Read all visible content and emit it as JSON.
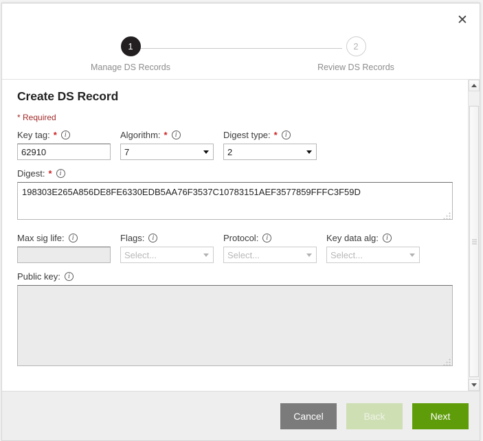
{
  "dialog": {
    "close_label": "✕"
  },
  "stepper": {
    "steps": [
      {
        "number": "1",
        "label": "Manage DS Records",
        "state": "active"
      },
      {
        "number": "2",
        "label": "Review DS Records",
        "state": "inactive"
      }
    ]
  },
  "form": {
    "title": "Create DS Record",
    "required_note": "* Required",
    "info_icon": "info-icon",
    "fields": {
      "key_tag": {
        "label": "Key tag:",
        "required": "*",
        "value": "62910",
        "placeholder": ""
      },
      "algorithm": {
        "label": "Algorithm:",
        "required": "*",
        "value": "7",
        "options": [
          "7"
        ]
      },
      "digest_type": {
        "label": "Digest type:",
        "required": "*",
        "value": "2",
        "options": [
          "2"
        ]
      },
      "digest": {
        "label": "Digest:",
        "required": "*",
        "value": "198303E265A856DE8FE6330EDB5AA76F3537C10783151AEF3577859FFFC3F59D"
      },
      "max_sig_life": {
        "label": "Max sig life:",
        "value": "",
        "placeholder": "",
        "disabled": true
      },
      "flags": {
        "label": "Flags:",
        "value": "Select...",
        "options": [
          "Select..."
        ],
        "disabled": true
      },
      "protocol": {
        "label": "Protocol:",
        "value": "Select...",
        "options": [
          "Select..."
        ],
        "disabled": true
      },
      "key_data_alg": {
        "label": "Key data alg:",
        "value": "Select...",
        "options": [
          "Select..."
        ],
        "disabled": true
      },
      "public_key": {
        "label": "Public key:",
        "value": "",
        "disabled": true
      }
    }
  },
  "footer": {
    "cancel_label": "Cancel",
    "back_label": "Back",
    "next_label": "Next"
  },
  "colors": {
    "step_active": "#231f20",
    "required_red": "#a32b2b",
    "next_green": "#5f9c0a",
    "back_green_disabled": "#cfdfb4",
    "cancel_grey": "#7b7b7b"
  }
}
